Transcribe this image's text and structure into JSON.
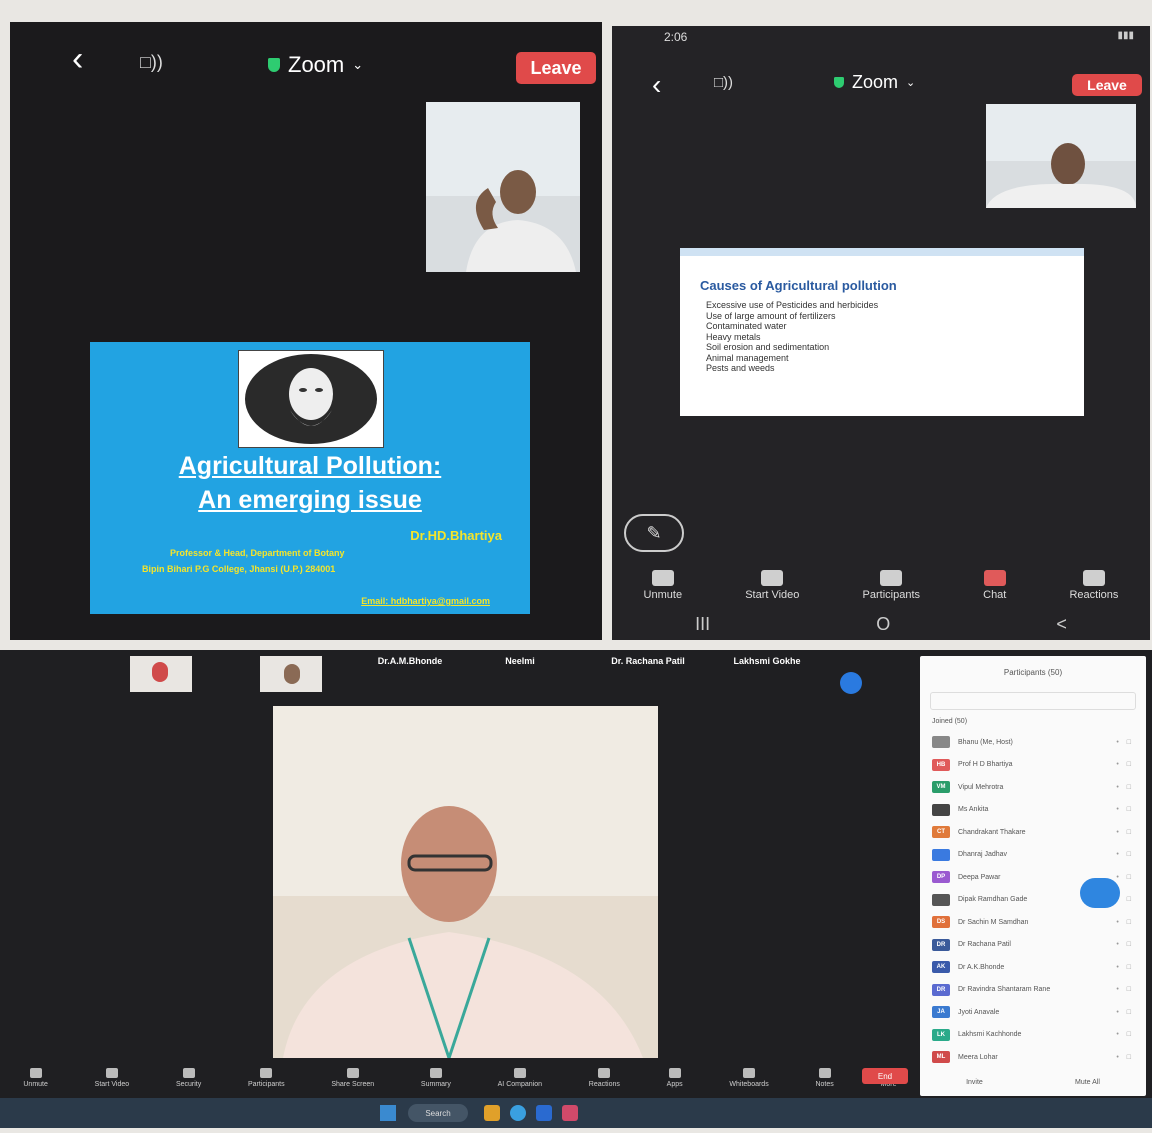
{
  "panel1": {
    "zoom_label": "Zoom",
    "leave_label": "Leave",
    "slide": {
      "title_line1": "Agricultural Pollution:",
      "title_line2": "An emerging issue",
      "author": "Dr.HD.Bhartiya",
      "affil1": "Professor & Head, Department of Botany",
      "affil2": "Bipin Bihari P.G College, Jhansi (U.P.) 284001",
      "email": "Email: hdbhartiya@gmail.com"
    }
  },
  "panel2": {
    "status_time": "2:06",
    "zoom_label": "Zoom",
    "leave_label": "Leave",
    "slide": {
      "heading": "Causes of Agricultural pollution",
      "bullets": [
        "Excessive use of Pesticides and herbicides",
        "Use of large amount of fertilizers",
        "Contaminated water",
        "Heavy metals",
        "Soil erosion and sedimentation",
        "Animal management",
        "Pests and weeds"
      ]
    },
    "toolbar": [
      "Unmute",
      "Start Video",
      "Participants",
      "Chat",
      "Reactions"
    ],
    "nav": [
      "III",
      "O",
      "<"
    ]
  },
  "panel3": {
    "strip_names": [
      "Dr.A.M.Bhonde",
      "Neelmi",
      "Dr. Rachana Patil",
      "Lakhsmi Gokhe"
    ],
    "participants_title": "Participants (50)",
    "participants_section": "Joined (50)",
    "participants": [
      {
        "initials": "",
        "name": "Bhanu (Me, Host)",
        "color": "#888"
      },
      {
        "initials": "HB",
        "name": "Prof H D Bhartiya",
        "color": "#e05a5a"
      },
      {
        "initials": "VM",
        "name": "Vipul Mehrotra",
        "color": "#2a9d6a"
      },
      {
        "initials": "",
        "name": "Ms Ankita",
        "color": "#444"
      },
      {
        "initials": "CT",
        "name": "Chandrakant Thakare",
        "color": "#e07a3a"
      },
      {
        "initials": "",
        "name": "Dhanraj Jadhav",
        "color": "#3a7ae0"
      },
      {
        "initials": "DP",
        "name": "Deepa Pawar",
        "color": "#9a5ad0"
      },
      {
        "initials": "",
        "name": "Dipak Ramdhan Gade",
        "color": "#555"
      },
      {
        "initials": "DS",
        "name": "Dr Sachin M Samdhan",
        "color": "#e0703a"
      },
      {
        "initials": "DR",
        "name": "Dr Rachana Patil",
        "color": "#3a5a9a"
      },
      {
        "initials": "AK",
        "name": "Dr A.K.Bhonde",
        "color": "#3a5aaa"
      },
      {
        "initials": "DR",
        "name": "Dr Ravindra Shantaram Rane",
        "color": "#5a6ad0"
      },
      {
        "initials": "JA",
        "name": "Jyoti Anavale",
        "color": "#3a7ad0"
      },
      {
        "initials": "LK",
        "name": "Lakhsmi Kachhonde",
        "color": "#2aaa8a"
      },
      {
        "initials": "ML",
        "name": "Meera Lohar",
        "color": "#d04a4a"
      }
    ],
    "invite_label": "Invite",
    "mute_all_label": "Mute All",
    "toolbar": [
      "Unmute",
      "Start Video",
      "Security",
      "Participants",
      "Share Screen",
      "Summary",
      "AI Companion",
      "Reactions",
      "Apps",
      "Whiteboards",
      "Notes",
      "More"
    ],
    "end_label": "End",
    "taskbar_search": "Search"
  }
}
